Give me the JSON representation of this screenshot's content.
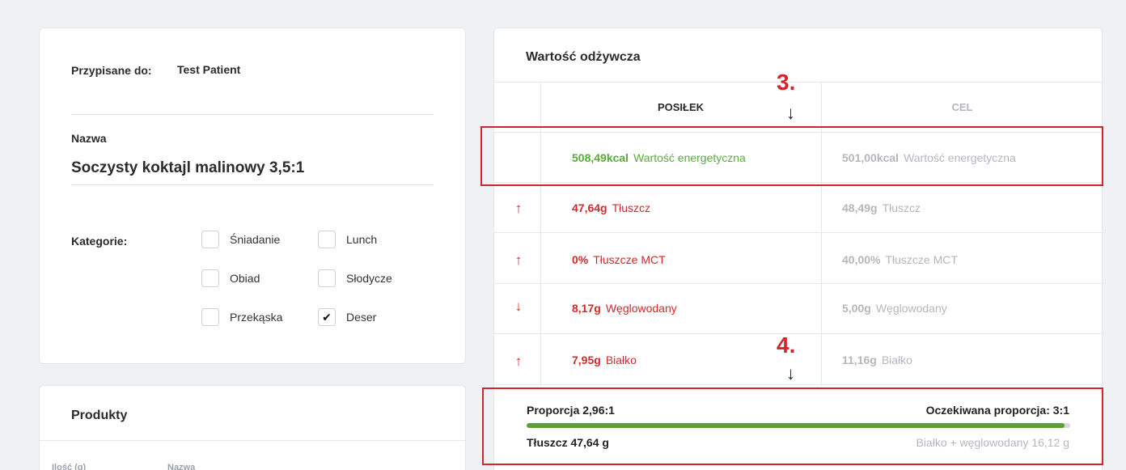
{
  "info": {
    "assigned_label": "Przypisane do:",
    "assigned_value": "Test Patient",
    "name_label": "Nazwa",
    "name_value": "Soczysty koktajl malinowy 3,5:1",
    "categories_label": "Kategorie:",
    "categories": [
      {
        "label": "Śniadanie",
        "checked": false
      },
      {
        "label": "Lunch",
        "checked": false
      },
      {
        "label": "Obiad",
        "checked": false
      },
      {
        "label": "Słodycze",
        "checked": false
      },
      {
        "label": "Przekąska",
        "checked": false
      },
      {
        "label": "Deser",
        "checked": true
      }
    ]
  },
  "products": {
    "title": "Produkty",
    "col_qty": "Ilość (g)",
    "col_name": "Nazwa"
  },
  "nutrition": {
    "title": "Wartość odżywcza",
    "col_meal": "POSIŁEK",
    "col_goal": "CEL",
    "rows": [
      {
        "indicator": "",
        "meal_value": "508,49kcal",
        "meal_label": "Wartość energetyczna",
        "goal_value": "501,00kcal",
        "goal_label": "Wartość energetyczna",
        "status": "ok"
      },
      {
        "indicator": "↑",
        "meal_value": "47,64g",
        "meal_label": "Tłuszcz",
        "goal_value": "48,49g",
        "goal_label": "Tłuszcz",
        "status": "bad"
      },
      {
        "indicator": "↑",
        "meal_value": "0%",
        "meal_label": "Tłuszcze MCT",
        "goal_value": "40,00%",
        "goal_label": "Tłuszcze MCT",
        "status": "bad"
      },
      {
        "indicator": "↓",
        "meal_value": "8,17g",
        "meal_label": "Węglowodany",
        "goal_value": "5,00g",
        "goal_label": "Węglowodany",
        "status": "bad"
      },
      {
        "indicator": "↑",
        "meal_value": "7,95g",
        "meal_label": "Białko",
        "goal_value": "11,16g",
        "goal_label": "Białko",
        "status": "bad"
      }
    ],
    "ratio_label": "Proporcja 2,96:1",
    "expected_ratio_label": "Oczekiwana proporcja: 3:1",
    "ratio_progress": 0.99,
    "fat_total": "Tłuszcz 47,64 g",
    "carb_protein_total": "Białko + węglowodany 16,12 g"
  },
  "annotations": {
    "label_3": "3.",
    "label_4": "4."
  },
  "colors": {
    "accent_green": "#5aab3c",
    "alert_red": "#d3282d",
    "annotation_red": "#d2262c",
    "muted_grey": "#b3b7bd"
  }
}
